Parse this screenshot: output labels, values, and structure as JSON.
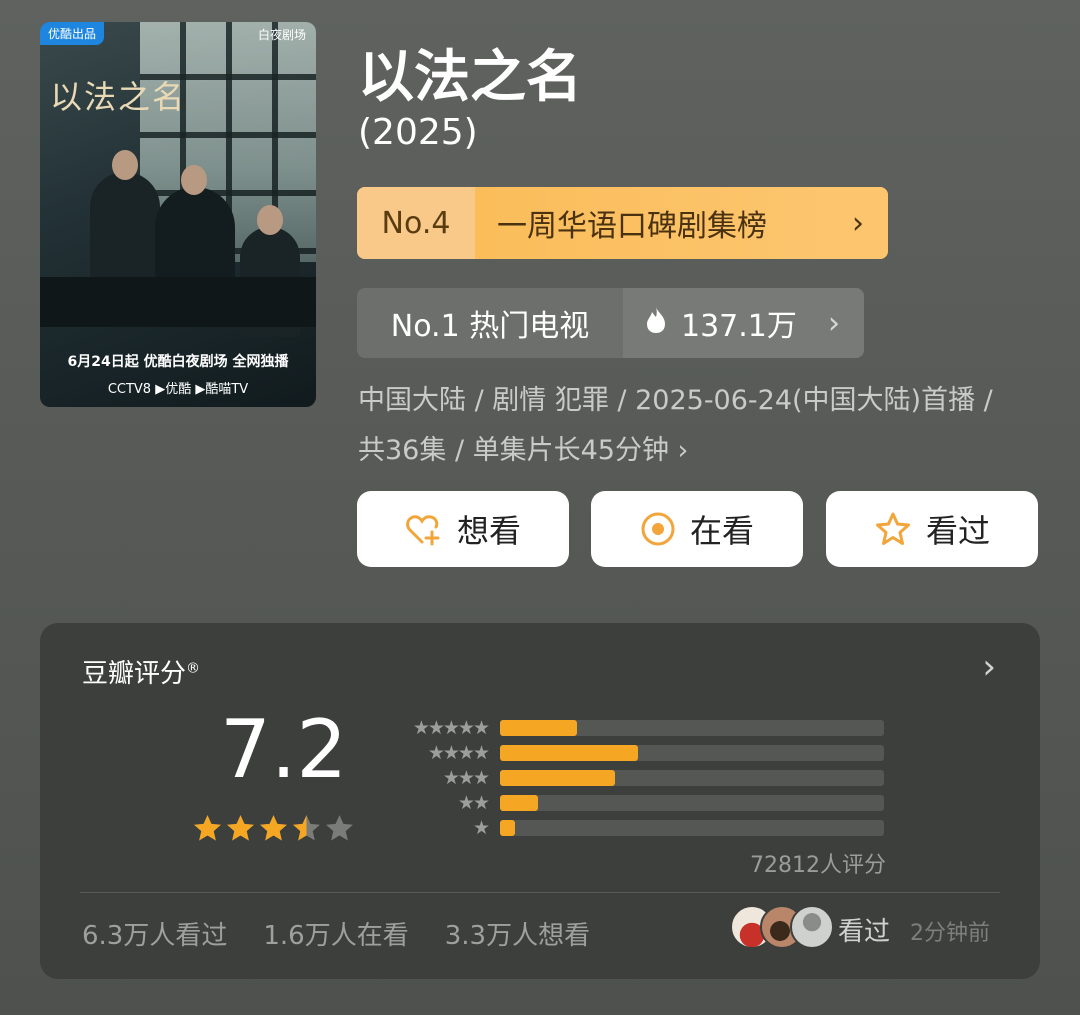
{
  "poster": {
    "brand_tag": "优酷出品",
    "theater_tag": "白夜剧场",
    "logo_text": "以法之名",
    "tagline": "6月24日起 优酷白夜剧场 全网独播",
    "platforms": "CCTV8 ▶优酷 ▶酷喵TV"
  },
  "title": "以法之名",
  "year": "(2025)",
  "rank_primary": {
    "number": "No.4",
    "label": "一周华语口碑剧集榜",
    "chevron": "›"
  },
  "rank_secondary": {
    "label": "No.1 热门电视",
    "heat": "137.1万",
    "chevron": "›"
  },
  "meta": "中国大陆 / 剧情 犯罪 / 2025-06-24(中国大陆)首播 / 共36集 / 单集片长45分钟 ›",
  "buttons": [
    {
      "label": "想看",
      "icon": "heart-plus-icon"
    },
    {
      "label": "在看",
      "icon": "target-icon"
    },
    {
      "label": "看过",
      "icon": "star-outline-icon"
    }
  ],
  "rating": {
    "header": "豆瓣评分",
    "registered": "®",
    "more": "›",
    "score": "7.2",
    "star_rating": 3.5,
    "star_distribution": [
      {
        "stars": "★★★★★",
        "fraction": 0.2
      },
      {
        "stars": "★★★★",
        "fraction": 0.36
      },
      {
        "stars": "★★★",
        "fraction": 0.3
      },
      {
        "stars": "★★",
        "fraction": 0.1
      },
      {
        "stars": "★",
        "fraction": 0.04
      }
    ],
    "count": "72812人评分",
    "stats": [
      "6.3万人看过",
      "1.6万人在看",
      "3.3万人想看"
    ],
    "seen_label": "看过",
    "seen_time": "2分钟前"
  },
  "colors": {
    "accent": "#f5a623",
    "rank_bg": "#fbbd5a",
    "card_bg": "#3c3f3c"
  }
}
